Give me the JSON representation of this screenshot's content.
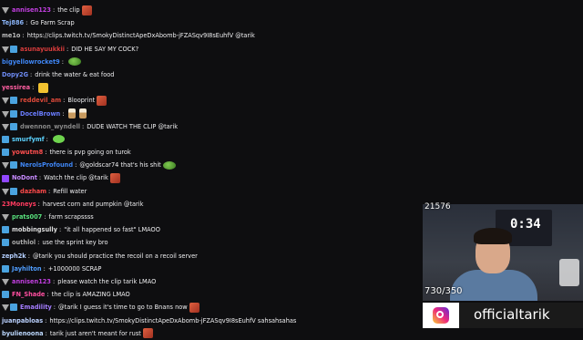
{
  "chat": {
    "messages": [
      {
        "badges": [
          "mod"
        ],
        "user": "annisen123",
        "color": "#c23fe0",
        "text": "the clip",
        "emote": "face"
      },
      {
        "badges": [],
        "user": "Tej886",
        "color": "#8ab4f8",
        "text": "Go Farm Scrap",
        "emote": null
      },
      {
        "badges": [],
        "user": "me1o",
        "color": "#bbbbbb",
        "text": "https://clips.twitch.tv/SmokyDistinctApeDxAbomb-jFZASqv9I8sEuhfV @tarik",
        "emote": null
      },
      {
        "badges": [
          "mod",
          "sub"
        ],
        "user": "asunayuukkii",
        "color": "#d83c3c",
        "text": "DID HE SAY MY COCK?",
        "emote": null
      },
      {
        "badges": [],
        "user": "bigyellowrocket9",
        "color": "#3f86f5",
        "text": "",
        "emote": "frog"
      },
      {
        "badges": [],
        "user": "Dopy2G",
        "color": "#6e8cf5",
        "text": "drink the water & eat food",
        "emote": null
      },
      {
        "badges": [],
        "user": "yessirea",
        "color": "#ff5fa2",
        "text": "",
        "emote": "hand"
      },
      {
        "badges": [
          "mod",
          "sub"
        ],
        "user": "reddevil_am",
        "color": "#e04a3a",
        "text": "Blooprint",
        "emote": "face"
      },
      {
        "badges": [
          "mod",
          "sub"
        ],
        "user": "DocelBrown",
        "color": "#6a7dff",
        "text": "",
        "emote": "cone"
      },
      {
        "badges": [
          "mod",
          "sub"
        ],
        "user": "dwennon_wyndell",
        "color": "#888888",
        "text": "DUDE WATCH THE CLIP @tarik",
        "emote": null
      },
      {
        "badges": [
          "sub"
        ],
        "user": "smurfymf",
        "color": "#5cd3ff",
        "text": "",
        "emote": "blob"
      },
      {
        "badges": [
          "sub"
        ],
        "user": "yowutm8",
        "color": "#ff4f4f",
        "text": "there is pvp going on turok",
        "emote": null
      },
      {
        "badges": [
          "mod",
          "sub"
        ],
        "user": "NerolsProfound",
        "color": "#3f86f5",
        "text": "@goldscar74 that's his shit",
        "emote": "frog"
      },
      {
        "badges": [
          "prime"
        ],
        "user": "NoDont",
        "color": "#c78bff",
        "text": "Watch the clip @tarik",
        "emote": "face"
      },
      {
        "badges": [
          "mod",
          "sub"
        ],
        "user": "dazham",
        "color": "#ff4a4a",
        "text": "Refill water",
        "emote": null
      },
      {
        "badges": [],
        "user": "23Moneys",
        "color": "#ff3b5f",
        "text": "harvest corn and pumpkin @tarik",
        "emote": null
      },
      {
        "badges": [
          "mod"
        ],
        "user": "prats007",
        "color": "#58e07c",
        "text": "farm scrapssss",
        "emote": null
      },
      {
        "badges": [
          "sub"
        ],
        "user": "mobbingsully",
        "color": "#dddddd",
        "text": "\"it all happened so fast\" LMAOO",
        "emote": null
      },
      {
        "badges": [
          "sub"
        ],
        "user": "outhlol",
        "color": "#aaaaaa",
        "text": "use the sprint key bro",
        "emote": null
      },
      {
        "badges": [],
        "user": "zeph2k",
        "color": "#b5d0ff",
        "text": "@tarik you should practice the recoil on a recoil server",
        "emote": null
      },
      {
        "badges": [
          "sub"
        ],
        "user": "Jayhilton",
        "color": "#4f9dff",
        "text": "+1000000 SCRAP",
        "emote": null
      },
      {
        "badges": [
          "mod"
        ],
        "user": "annisen123",
        "color": "#c23fe0",
        "text": "please watch the clip tarik LMAO",
        "emote": null
      },
      {
        "badges": [
          "sub"
        ],
        "user": "FN_Shade",
        "color": "#ff4fa0",
        "text": "the clip is AMAZING LMAO",
        "emote": null
      },
      {
        "badges": [
          "mod",
          "sub"
        ],
        "user": "Emadility",
        "color": "#a47dff",
        "text": "@tarik I guess it's time to go to Bnans now",
        "emote": "face"
      },
      {
        "badges": [],
        "user": "juanpabloas",
        "color": "#bbd1ff",
        "text": "https://clips.twitch.tv/SmokyDistinctApeDxAbomb-jFZASqv9I8sEuhfV sahsahsahas",
        "emote": null
      },
      {
        "badges": [],
        "user": "byulienoona",
        "color": "#bcd8ff",
        "text": "tarik just aren't meant for rust",
        "emote": "face"
      }
    ]
  },
  "overlay": {
    "viewer_count": "21576",
    "resolution": "730/350",
    "clock": "0:34"
  },
  "social": {
    "handle": "officialtarik",
    "icon": "instagram-icon"
  }
}
